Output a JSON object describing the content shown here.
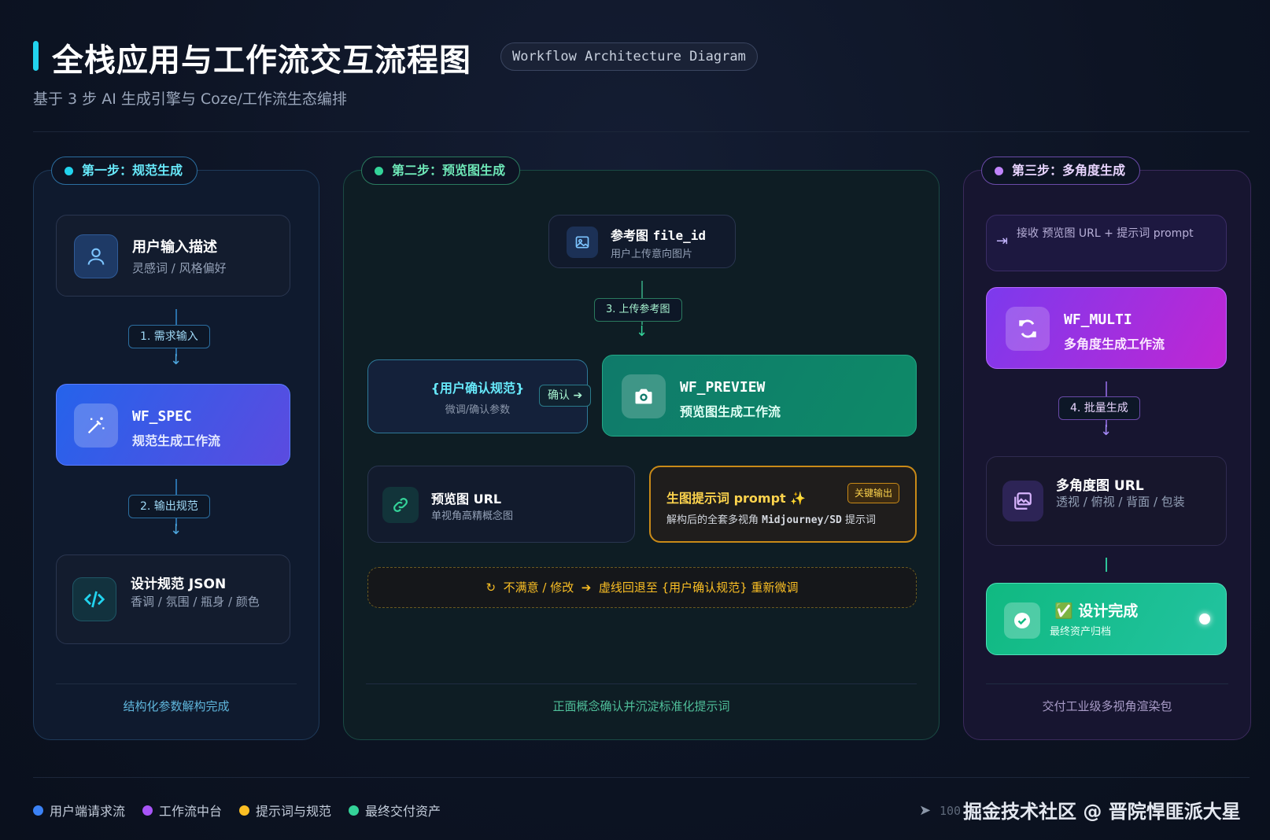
{
  "header": {
    "title": "全栈应用与工作流交互流程图",
    "badge": "Workflow Architecture Diagram",
    "subtitle": "基于 3 步 AI 生成引擎与 Coze/工作流生态编排"
  },
  "colors": {
    "step1": "#22d3ee",
    "step2": "#34d399",
    "step3": "#c084fc",
    "prompt": "#fbbf24"
  },
  "step1": {
    "label": "第一步：规范生成",
    "input_card": {
      "icon": "user-icon",
      "title": "用户输入描述",
      "subtitle": "灵感词 / 风格偏好"
    },
    "edge1": "1. 需求输入",
    "wf_card": {
      "icon": "magic-wand-icon",
      "title": "WF_SPEC",
      "subtitle": "规范生成工作流"
    },
    "edge2": "2. 输出规范",
    "output_card": {
      "icon": "code-icon",
      "title": "设计规范 JSON",
      "subtitle": "香调 / 氛围 / 瓶身 / 颜色"
    },
    "footer": "结构化参数解构完成"
  },
  "step2": {
    "label": "第二步：预览图生成",
    "ref_card": {
      "icon": "image-icon",
      "title": "参考图 ",
      "title_code": "file_id",
      "subtitle": "用户上传意向图片"
    },
    "edge3": "3. 上传参考图",
    "confirm_card": {
      "title": "{用户确认规范}",
      "subtitle": "微调/确认参数"
    },
    "confirm_edge": "确认 ➔",
    "wf_card": {
      "icon": "camera-icon",
      "title": "WF_PREVIEW",
      "subtitle": "预览图生成工作流"
    },
    "url_card": {
      "icon": "link-icon",
      "title": "预览图 URL",
      "subtitle": "单视角高精概念图"
    },
    "prompt_card": {
      "title": "生图提示词 prompt",
      "sparkle": "✨",
      "badge": "关键输出",
      "subtitle_a": "解构后的全套多视角 ",
      "subtitle_code": "Midjourney/SD",
      "subtitle_b": " 提示词"
    },
    "retry": {
      "icon": "↻",
      "text_a": "不满意 / 修改",
      "arrow": "➔",
      "text_b": "虚线回退至 {用户确认规范} 重新微调"
    },
    "footer": "正面概念确认并沉淀标准化提示词"
  },
  "step3": {
    "label": "第三步：多角度生成",
    "input_card": {
      "icon": "login-arrow-icon",
      "text": "接收 预览图 URL + 提示词 prompt"
    },
    "wf_card": {
      "icon": "refresh-icon",
      "title": "WF_MULTI",
      "subtitle": "多角度生成工作流"
    },
    "edge4": "4. 批量生成",
    "url_card": {
      "icon": "images-icon",
      "title": "多角度图 URL",
      "subtitle": "透视 / 俯视 / 背面 / 包装"
    },
    "done_card": {
      "icon": "check-circle-icon",
      "check": "✅",
      "title": "设计完成",
      "subtitle": "最终资产归档"
    },
    "footer": "交付工业级多视角渲染包"
  },
  "legend": [
    {
      "label": "用户端请求流",
      "color": "#3b82f6"
    },
    {
      "label": "工作流中台",
      "color": "#a855f7"
    },
    {
      "label": "提示词与规范",
      "color": "#fbbf24"
    },
    {
      "label": "最终交付资产",
      "color": "#34d399"
    }
  ],
  "watermark": {
    "number": "100",
    "text": "掘金技术社区 @ 晋院悍匪派大星"
  }
}
